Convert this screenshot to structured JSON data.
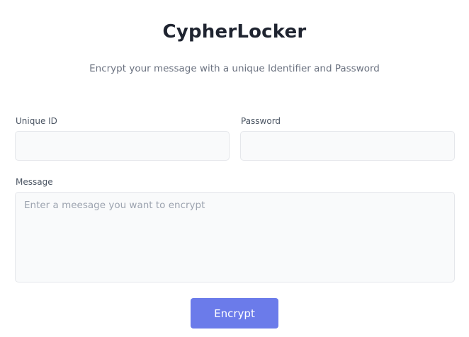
{
  "header": {
    "title": "CypherLocker",
    "subtitle": "Encrypt your message with a unique Identifier and Password"
  },
  "form": {
    "unique_id": {
      "label": "Unique ID",
      "value": "",
      "placeholder": ""
    },
    "password": {
      "label": "Password",
      "value": "",
      "placeholder": ""
    },
    "message": {
      "label": "Message",
      "value": "",
      "placeholder": "Enter a meesage you want to encrypt"
    },
    "submit_label": "Encrypt"
  },
  "colors": {
    "accent": "#6b7bea",
    "title": "#1f2430",
    "subtitle": "#6b7280",
    "field_background": "#f9fafb",
    "field_border": "#e5e7eb"
  }
}
